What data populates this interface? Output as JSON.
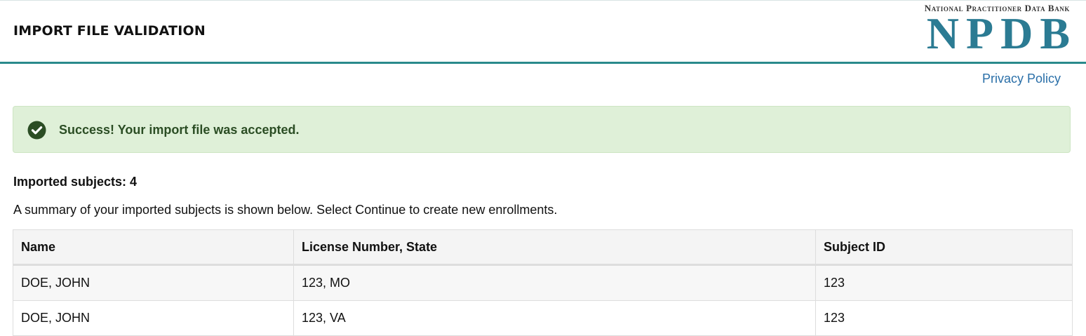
{
  "header": {
    "title": "IMPORT FILE VALIDATION",
    "logo_subtitle": "National Practitioner Data Bank",
    "logo_main": "NPDB"
  },
  "links": {
    "privacy": "Privacy Policy"
  },
  "alert": {
    "message": "Success! Your import file was accepted.",
    "icon": "check-circle-icon",
    "color": "#2b4d24"
  },
  "summary": {
    "count_label": "Imported subjects:",
    "count_value": "4",
    "description": "A summary of your imported subjects is shown below. Select Continue to create new enrollments."
  },
  "table": {
    "columns": [
      "Name",
      "License Number, State",
      "Subject ID"
    ],
    "rows": [
      [
        "DOE, JOHN",
        "123, MO",
        "123"
      ],
      [
        "DOE, JOHN",
        "123, VA",
        "123"
      ]
    ]
  },
  "colors": {
    "accent": "#2a8a8c",
    "logo": "#2b7b93",
    "link": "#2a6fa8",
    "success_bg": "#dff0d8"
  }
}
